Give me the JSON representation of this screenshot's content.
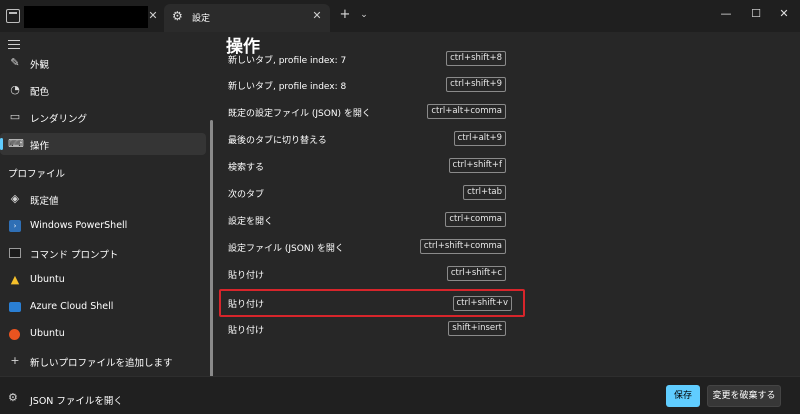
{
  "tabs": [
    {
      "label": ""
    },
    {
      "label": "設定",
      "icon": "gear-icon"
    }
  ],
  "window_controls": {
    "minimize": "—",
    "maximize": "☐",
    "close": "✕"
  },
  "sidebar": {
    "items": [
      {
        "label": "外観",
        "icon": "pencil-icon"
      },
      {
        "label": "配色",
        "icon": "palette-icon"
      },
      {
        "label": "レンダリング",
        "icon": "monitor-icon"
      },
      {
        "label": "操作",
        "icon": "keyboard-icon",
        "selected": true
      }
    ],
    "profiles_header": "プロファイル",
    "profiles": [
      {
        "label": "既定値",
        "icon": "layers-icon"
      },
      {
        "label": "Windows PowerShell",
        "icon": "powershell-icon"
      },
      {
        "label": "コマンド プロンプト",
        "icon": "cmd-icon"
      },
      {
        "label": "Ubuntu",
        "icon": "tux-icon"
      },
      {
        "label": "Azure Cloud Shell",
        "icon": "azure-icon"
      },
      {
        "label": "Ubuntu",
        "icon": "ubuntu-icon"
      },
      {
        "label": "新しいプロファイルを追加します",
        "icon": "plus-icon"
      }
    ]
  },
  "main": {
    "title": "操作",
    "partial_row": {
      "label": "新しいタブ, profile index: 7",
      "key": "ctrl+shift+8"
    },
    "rows": [
      {
        "label": "新しいタブ, profile index: 8",
        "key": "ctrl+shift+9"
      },
      {
        "label": "既定の設定ファイル (JSON) を開く",
        "key": "ctrl+alt+comma"
      },
      {
        "label": "最後のタブに切り替える",
        "key": "ctrl+alt+9"
      },
      {
        "label": "検索する",
        "key": "ctrl+shift+f"
      },
      {
        "label": "次のタブ",
        "key": "ctrl+tab"
      },
      {
        "label": "設定を開く",
        "key": "ctrl+comma"
      },
      {
        "label": "設定ファイル (JSON) を開く",
        "key": "ctrl+shift+comma"
      },
      {
        "label": "貼り付け",
        "key": "ctrl+shift+c"
      },
      {
        "label": "貼り付け",
        "key": "ctrl+shift+v",
        "highlighted": true
      },
      {
        "label": "貼り付け",
        "key": "shift+insert"
      }
    ]
  },
  "footer": {
    "json_link": "JSON ファイルを開く",
    "save": "保存",
    "discard": "変更を破棄する"
  },
  "colors": {
    "accent": "#60cdff",
    "highlight": "#d7252b"
  }
}
